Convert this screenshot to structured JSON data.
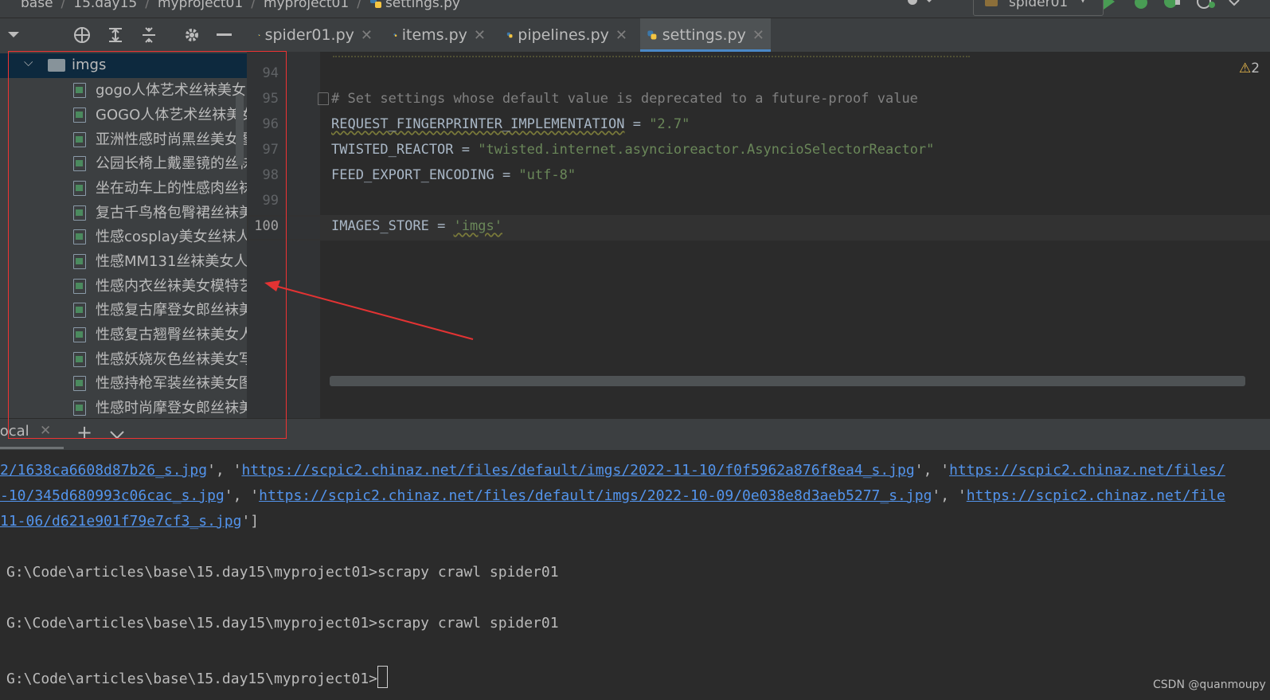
{
  "breadcrumb": {
    "items": [
      "base",
      "15.day15",
      "myproject01",
      "myproject01",
      "settings.py"
    ]
  },
  "run_config": {
    "label": "spider01"
  },
  "editor_tabs": [
    {
      "label": "spider01.py",
      "active": false
    },
    {
      "label": "items.py",
      "active": false
    },
    {
      "label": "pipelines.py",
      "active": false
    },
    {
      "label": "settings.py",
      "active": true
    }
  ],
  "project_tree": {
    "folder": "imgs",
    "files": [
      "gogo人体艺术丝袜美女",
      "GOGO人体艺术丝袜美女",
      "亚洲性感时尚黑丝美女图",
      "公园长椅上戴墨镜的丝袜",
      "坐在动车上的性感肉丝袜",
      "复古千鸟格包臀裙丝袜美",
      "性感cosplay美女丝袜人",
      "性感MM131丝袜美女人",
      "性感内衣丝袜美女模特艺",
      "性感复古摩登女郎丝袜美",
      "性感复古翘臀丝袜美女人",
      "性感妖娆灰色丝袜美女写",
      "性感持枪军装丝袜美女图",
      "性感时尚摩登女郎丝袜美"
    ]
  },
  "editor": {
    "warning_count": "2",
    "lines": [
      {
        "no": "94",
        "comment": "",
        "name": "",
        "op": "",
        "value": ""
      },
      {
        "no": "95",
        "comment": "# Set settings whose default value is deprecated to a future-proof value",
        "name": "",
        "op": "",
        "value": ""
      },
      {
        "no": "96",
        "comment": "",
        "name": "REQUEST_FINGERPRINTER_IMPLEMENTATION",
        "op": " = ",
        "value": "\"2.7\""
      },
      {
        "no": "97",
        "comment": "",
        "name": "TWISTED_REACTOR",
        "op": " = ",
        "value": "\"twisted.internet.asyncioreactor.AsyncioSelectorReactor\""
      },
      {
        "no": "98",
        "comment": "",
        "name": "FEED_EXPORT_ENCODING",
        "op": " = ",
        "value": "\"utf-8\""
      },
      {
        "no": "99",
        "comment": "",
        "name": "",
        "op": "",
        "value": ""
      },
      {
        "no": "100",
        "comment": "",
        "name": "IMAGES_STORE",
        "op": " = ",
        "value": "'imgs'"
      }
    ]
  },
  "terminal": {
    "tab_label": "Local",
    "output_lines": [
      {
        "parts": [
          {
            "t": "url",
            "v": "2/1638ca6608d87b26_s.jpg"
          },
          {
            "t": "txt",
            "v": "', '"
          },
          {
            "t": "url",
            "v": "https://scpic2.chinaz.net/files/default/imgs/2022-11-10/f0f5962a876f8ea4_s.jpg"
          },
          {
            "t": "txt",
            "v": "', '"
          },
          {
            "t": "url",
            "v": "https://scpic2.chinaz.net/files/"
          }
        ]
      },
      {
        "parts": [
          {
            "t": "url",
            "v": "-10/345d680993c06cac_s.jpg"
          },
          {
            "t": "txt",
            "v": "', '"
          },
          {
            "t": "url",
            "v": "https://scpic2.chinaz.net/files/default/imgs/2022-10-09/0e038e8d3aeb5277_s.jpg"
          },
          {
            "t": "txt",
            "v": "', '"
          },
          {
            "t": "url",
            "v": "https://scpic2.chinaz.net/file"
          }
        ]
      },
      {
        "parts": [
          {
            "t": "url",
            "v": "11-06/d621e901f79e7cf3_s.jpg"
          },
          {
            "t": "txt",
            "v": "']"
          }
        ]
      }
    ],
    "commands": [
      "G:\\Code\\articles\\base\\15.day15\\myproject01>scrapy crawl spider01",
      "G:\\Code\\articles\\base\\15.day15\\myproject01>scrapy crawl spider01"
    ],
    "prompt": "G:\\Code\\articles\\base\\15.day15\\myproject01>"
  },
  "watermark": "CSDN @quanmoupy",
  "colors": {
    "accent": "#4a88c7",
    "annotation": "#e33333",
    "link": "#5394ec",
    "string": "#6a8759",
    "comment": "#808080"
  }
}
